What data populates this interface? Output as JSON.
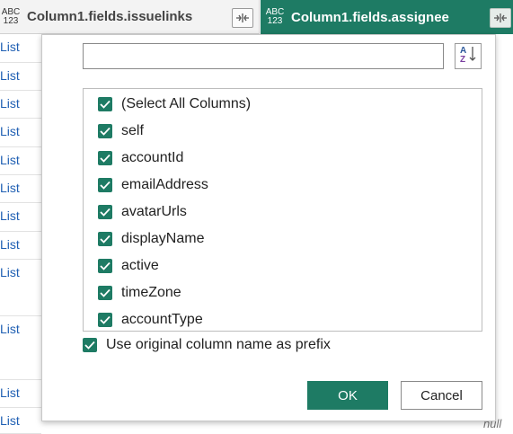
{
  "headers": [
    {
      "type_top": "ABC",
      "type_bottom": "123",
      "title": "Column1.fields.issuelinks"
    },
    {
      "type_top": "ABC",
      "type_bottom": "123",
      "title": "Column1.fields.assignee"
    }
  ],
  "left_cells": [
    "List",
    "List",
    "List",
    "List",
    "List",
    "List",
    "List",
    "List",
    "List",
    "List",
    "List",
    "List"
  ],
  "right_cell_text": "null",
  "dialog": {
    "search_value": "",
    "columns": [
      {
        "label": "(Select All Columns)",
        "checked": true
      },
      {
        "label": "self",
        "checked": true
      },
      {
        "label": "accountId",
        "checked": true
      },
      {
        "label": "emailAddress",
        "checked": true
      },
      {
        "label": "avatarUrls",
        "checked": true
      },
      {
        "label": "displayName",
        "checked": true
      },
      {
        "label": "active",
        "checked": true
      },
      {
        "label": "timeZone",
        "checked": true
      },
      {
        "label": "accountType",
        "checked": true
      }
    ],
    "prefix_label": "Use original column name as prefix",
    "prefix_checked": true,
    "ok_label": "OK",
    "cancel_label": "Cancel"
  },
  "colors": {
    "accent": "#1e7b64",
    "highlight_bar": "#1aa090",
    "link_text": "#1f5fb3"
  },
  "icons": {
    "expand": "expand-columns-icon",
    "sort": "sort-az-icon",
    "check": "check-icon"
  }
}
